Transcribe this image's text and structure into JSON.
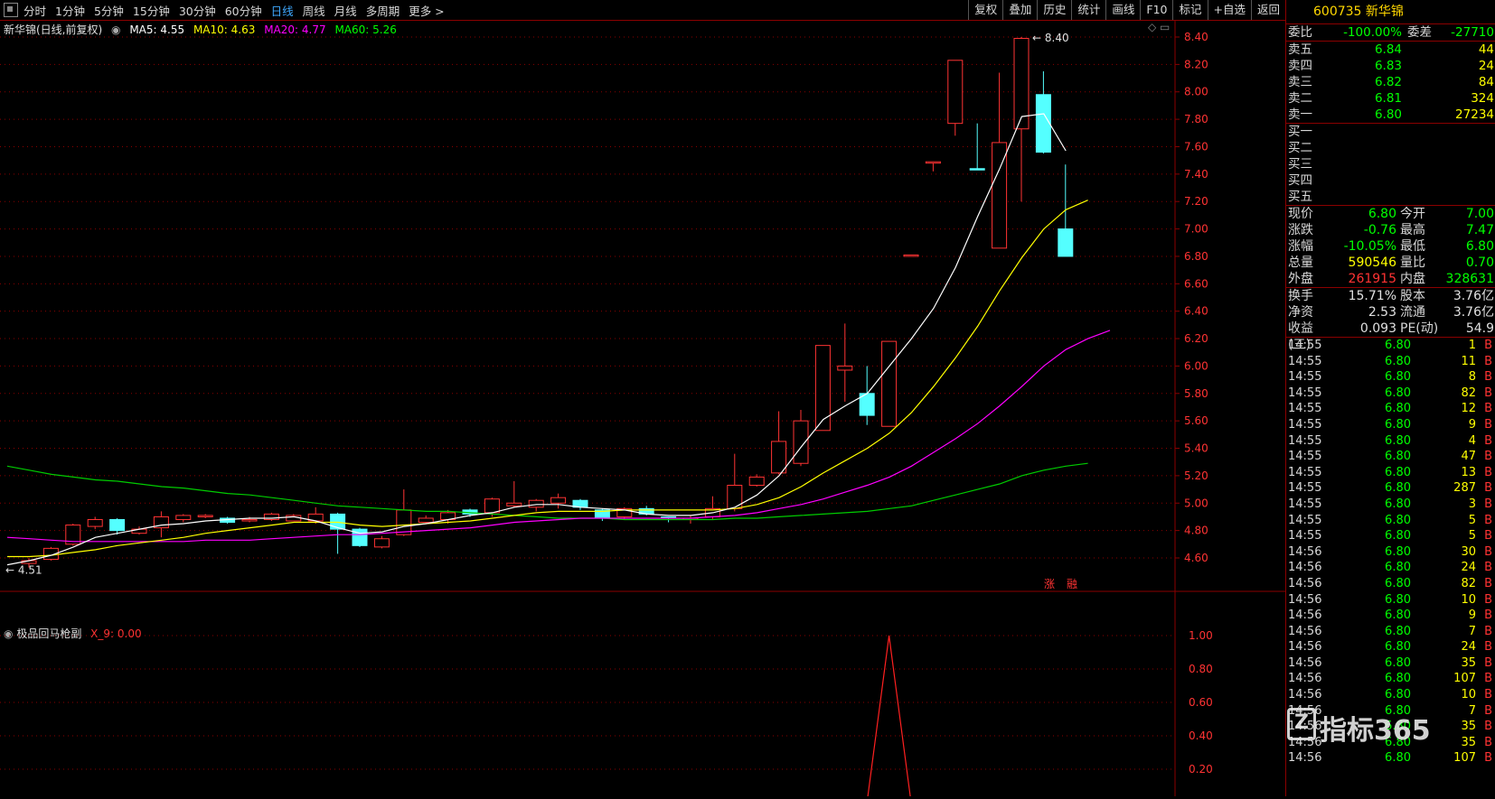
{
  "toolbar": {
    "periods": [
      "分时",
      "1分钟",
      "5分钟",
      "15分钟",
      "30分钟",
      "60分钟",
      "日线",
      "周线",
      "月线",
      "多周期",
      "更多 >"
    ],
    "active_period": "日线",
    "right_buttons": [
      "复权",
      "叠加",
      "历史",
      "统计",
      "画线",
      "F10",
      "标记",
      "+自选",
      "返回"
    ]
  },
  "legend": {
    "name": "新华锦(日线,前复权)",
    "ma5": "MA5: 4.55",
    "ma10": "MA10: 4.63",
    "ma20": "MA20: 4.77",
    "ma60": "MA60: 5.26"
  },
  "indicator_legend": {
    "name": "极品回马枪副",
    "x9": "X_9: 0.00"
  },
  "annotations": {
    "high_label": "8.40",
    "low_label": "4.51",
    "tag_zhang": "涨",
    "tag_shang": "融"
  },
  "colors": {
    "up": "#ff3333",
    "down": "#54ffff",
    "ma5": "#ffffff",
    "ma10": "#ffff00",
    "ma20": "#ff00ff",
    "ma60": "#00cc00",
    "grid": "#8b0000"
  },
  "chart_data": {
    "type": "candlestick",
    "price_axis": {
      "min": 4.4,
      "max": 8.5,
      "ticks": [
        "8.40",
        "8.20",
        "8.00",
        "7.80",
        "7.60",
        "7.40",
        "7.20",
        "7.00",
        "6.80",
        "6.60",
        "6.40",
        "6.20",
        "6.00",
        "5.80",
        "5.60",
        "5.40",
        "5.20",
        "5.00",
        "4.80",
        "4.60"
      ]
    },
    "candles": [
      {
        "o": 4.56,
        "c": 4.58,
        "h": 4.6,
        "l": 4.53
      },
      {
        "o": 4.59,
        "c": 4.67,
        "h": 4.68,
        "l": 4.58
      },
      {
        "o": 4.7,
        "c": 4.84,
        "h": 4.85,
        "l": 4.69
      },
      {
        "o": 4.83,
        "c": 4.88,
        "h": 4.9,
        "l": 4.81
      },
      {
        "o": 4.88,
        "c": 4.8,
        "h": 4.89,
        "l": 4.77
      },
      {
        "o": 4.78,
        "c": 4.81,
        "h": 4.83,
        "l": 4.77
      },
      {
        "o": 4.82,
        "c": 4.9,
        "h": 4.94,
        "l": 4.75
      },
      {
        "o": 4.88,
        "c": 4.91,
        "h": 4.92,
        "l": 4.86
      },
      {
        "o": 4.91,
        "c": 4.91,
        "h": 4.92,
        "l": 4.89
      },
      {
        "o": 4.89,
        "c": 4.86,
        "h": 4.9,
        "l": 4.85
      },
      {
        "o": 4.87,
        "c": 4.88,
        "h": 4.9,
        "l": 4.86
      },
      {
        "o": 4.88,
        "c": 4.92,
        "h": 4.93,
        "l": 4.87
      },
      {
        "o": 4.87,
        "c": 4.91,
        "h": 4.92,
        "l": 4.87
      },
      {
        "o": 4.87,
        "c": 4.92,
        "h": 4.97,
        "l": 4.85
      },
      {
        "o": 4.92,
        "c": 4.81,
        "h": 4.93,
        "l": 4.63
      },
      {
        "o": 4.81,
        "c": 4.69,
        "h": 4.82,
        "l": 4.68
      },
      {
        "o": 4.68,
        "c": 4.74,
        "h": 4.76,
        "l": 4.67
      },
      {
        "o": 4.77,
        "c": 4.95,
        "h": 5.1,
        "l": 4.76
      },
      {
        "o": 4.86,
        "c": 4.89,
        "h": 4.91,
        "l": 4.85
      },
      {
        "o": 4.88,
        "c": 4.93,
        "h": 4.95,
        "l": 4.85
      },
      {
        "o": 4.95,
        "c": 4.92,
        "h": 4.96,
        "l": 4.9
      },
      {
        "o": 4.93,
        "c": 5.03,
        "h": 5.04,
        "l": 4.9
      },
      {
        "o": 4.98,
        "c": 5.0,
        "h": 5.16,
        "l": 4.97
      },
      {
        "o": 4.97,
        "c": 5.02,
        "h": 5.03,
        "l": 4.94
      },
      {
        "o": 5.0,
        "c": 5.04,
        "h": 5.07,
        "l": 4.96
      },
      {
        "o": 5.02,
        "c": 4.97,
        "h": 5.03,
        "l": 4.95
      },
      {
        "o": 4.95,
        "c": 4.89,
        "h": 4.96,
        "l": 4.87
      },
      {
        "o": 4.9,
        "c": 4.96,
        "h": 4.97,
        "l": 4.88
      },
      {
        "o": 4.96,
        "c": 4.92,
        "h": 4.98,
        "l": 4.91
      },
      {
        "o": 4.9,
        "c": 4.89,
        "h": 4.9,
        "l": 4.86
      },
      {
        "o": 4.89,
        "c": 4.89,
        "h": 4.91,
        "l": 4.85
      },
      {
        "o": 4.9,
        "c": 4.96,
        "h": 5.05,
        "l": 4.88
      },
      {
        "o": 4.96,
        "c": 5.13,
        "h": 5.36,
        "l": 4.94
      },
      {
        "o": 5.13,
        "c": 5.19,
        "h": 5.21,
        "l": 5.12
      },
      {
        "o": 5.22,
        "c": 5.45,
        "h": 5.67,
        "l": 5.21
      },
      {
        "o": 5.29,
        "c": 5.6,
        "h": 5.68,
        "l": 5.27
      },
      {
        "o": 5.53,
        "c": 6.15,
        "h": 6.15,
        "l": 5.53
      },
      {
        "o": 5.97,
        "c": 6.0,
        "h": 6.31,
        "l": 5.74
      },
      {
        "o": 5.8,
        "c": 5.64,
        "h": 6.0,
        "l": 5.57
      },
      {
        "o": 5.56,
        "c": 6.18,
        "h": 6.18,
        "l": 5.56
      },
      {
        "o": 6.81,
        "c": 6.81,
        "h": 6.81,
        "l": 6.81
      },
      {
        "o": 7.49,
        "c": 7.49,
        "h": 7.49,
        "l": 7.42
      },
      {
        "o": 7.77,
        "c": 8.23,
        "h": 8.23,
        "l": 7.68
      },
      {
        "o": 7.44,
        "c": 7.43,
        "h": 7.77,
        "l": 7.43
      },
      {
        "o": 6.86,
        "c": 7.63,
        "h": 8.14,
        "l": 6.86
      },
      {
        "o": 7.73,
        "c": 8.39,
        "h": 8.4,
        "l": 7.2
      },
      {
        "o": 7.98,
        "c": 7.56,
        "h": 8.15,
        "l": 7.55
      },
      {
        "o": 7.0,
        "c": 6.8,
        "h": 7.47,
        "l": 6.8
      }
    ],
    "ma5": [
      4.55,
      4.58,
      4.62,
      4.68,
      4.75,
      4.78,
      4.81,
      4.84,
      4.85,
      4.87,
      4.88,
      4.89,
      4.89,
      4.9,
      4.87,
      4.82,
      4.78,
      4.79,
      4.83,
      4.85,
      4.88,
      4.91,
      4.93,
      4.97,
      4.99,
      4.99,
      4.97,
      4.96,
      4.95,
      4.92,
      4.91,
      4.91,
      4.93,
      4.97,
      5.06,
      5.2,
      5.41,
      5.61,
      5.71,
      5.8,
      6.0,
      6.2,
      6.42,
      6.72,
      7.09,
      7.44,
      7.82,
      7.84,
      7.57
    ],
    "ma10": [
      4.61,
      4.61,
      4.62,
      4.64,
      4.66,
      4.69,
      4.71,
      4.73,
      4.75,
      4.78,
      4.8,
      4.82,
      4.84,
      4.86,
      4.86,
      4.86,
      4.84,
      4.83,
      4.84,
      4.85,
      4.86,
      4.87,
      4.89,
      4.91,
      4.93,
      4.94,
      4.94,
      4.94,
      4.95,
      4.95,
      4.95,
      4.95,
      4.95,
      4.96,
      4.99,
      5.04,
      5.12,
      5.22,
      5.31,
      5.4,
      5.51,
      5.66,
      5.85,
      6.06,
      6.29,
      6.55,
      6.79,
      7.0,
      7.14,
      7.21
    ],
    "ma20": [
      4.75,
      4.74,
      4.73,
      4.72,
      4.72,
      4.72,
      4.72,
      4.72,
      4.72,
      4.73,
      4.73,
      4.73,
      4.74,
      4.75,
      4.76,
      4.77,
      4.77,
      4.78,
      4.79,
      4.8,
      4.81,
      4.82,
      4.84,
      4.86,
      4.87,
      4.88,
      4.89,
      4.89,
      4.89,
      4.89,
      4.89,
      4.89,
      4.9,
      4.91,
      4.93,
      4.96,
      4.99,
      5.03,
      5.08,
      5.13,
      5.19,
      5.27,
      5.37,
      5.47,
      5.58,
      5.71,
      5.85,
      6.0,
      6.12,
      6.2,
      6.26
    ],
    "ma60": [
      5.27,
      5.24,
      5.21,
      5.19,
      5.17,
      5.16,
      5.14,
      5.12,
      5.11,
      5.09,
      5.07,
      5.06,
      5.04,
      5.02,
      5.0,
      4.98,
      4.97,
      4.96,
      4.95,
      4.94,
      4.94,
      4.93,
      4.92,
      4.91,
      4.9,
      4.89,
      4.89,
      4.89,
      4.88,
      4.88,
      4.88,
      4.88,
      4.88,
      4.89,
      4.89,
      4.9,
      4.91,
      4.92,
      4.93,
      4.94,
      4.96,
      4.98,
      5.02,
      5.06,
      5.1,
      5.14,
      5.2,
      5.24,
      5.27,
      5.29
    ],
    "indicator": {
      "name": "极品回马枪副",
      "ticks": [
        "1.00",
        "0.80",
        "0.60",
        "0.40",
        "0.20"
      ],
      "min": 0.1,
      "max": 1.05,
      "values": [
        0,
        0,
        0,
        0,
        0,
        0,
        0,
        0,
        0,
        0,
        0,
        0,
        0,
        0,
        0,
        0,
        0,
        0,
        0,
        0,
        0,
        0,
        0,
        0,
        0,
        0,
        0,
        0,
        0,
        0,
        0,
        0,
        0,
        0,
        0,
        0,
        0,
        0,
        0,
        1,
        0,
        0,
        0,
        0,
        0,
        0,
        0,
        0,
        0
      ]
    }
  },
  "panel": {
    "code_name": "600735 新华锦",
    "weibi": {
      "label": "委比",
      "value": "-100.00%",
      "label2": "委差",
      "value2": "-27710"
    },
    "asks": [
      {
        "label": "卖五",
        "price": "6.84",
        "vol": "44"
      },
      {
        "label": "卖四",
        "price": "6.83",
        "vol": "24"
      },
      {
        "label": "卖三",
        "price": "6.82",
        "vol": "84"
      },
      {
        "label": "卖二",
        "price": "6.81",
        "vol": "324"
      },
      {
        "label": "卖一",
        "price": "6.80",
        "vol": "27234"
      }
    ],
    "bids": [
      {
        "label": "买一"
      },
      {
        "label": "买二"
      },
      {
        "label": "买三"
      },
      {
        "label": "买四"
      },
      {
        "label": "买五"
      }
    ],
    "quote": [
      {
        "l1": "现价",
        "v1": "6.80",
        "l2": "今开",
        "v2": "7.00",
        "c1": "green",
        "c2": "green"
      },
      {
        "l1": "涨跌",
        "v1": "-0.76",
        "l2": "最高",
        "v2": "7.47",
        "c1": "green",
        "c2": "green"
      },
      {
        "l1": "涨幅",
        "v1": "-10.05%",
        "l2": "最低",
        "v2": "6.80",
        "c1": "green",
        "c2": "green"
      },
      {
        "l1": "总量",
        "v1": "590546",
        "l2": "量比",
        "v2": "0.70",
        "c1": "yellow",
        "c2": "green"
      },
      {
        "l1": "外盘",
        "v1": "261915",
        "l2": "内盘",
        "v2": "328631",
        "c1": "red",
        "c2": "green"
      }
    ],
    "fund": [
      {
        "l1": "换手",
        "v1": "15.71%",
        "l2": "股本",
        "v2": "3.76亿"
      },
      {
        "l1": "净资",
        "v1": "2.53",
        "l2": "流通",
        "v2": "3.76亿"
      },
      {
        "l1": "收益(三)",
        "v1": "0.093",
        "l2": "PE(动)",
        "v2": "54.9"
      }
    ],
    "ticks": [
      {
        "t": "14:55",
        "p": "6.80",
        "v": "1",
        "s": "B"
      },
      {
        "t": "14:55",
        "p": "6.80",
        "v": "11",
        "s": "B"
      },
      {
        "t": "14:55",
        "p": "6.80",
        "v": "8",
        "s": "B"
      },
      {
        "t": "14:55",
        "p": "6.80",
        "v": "82",
        "s": "B"
      },
      {
        "t": "14:55",
        "p": "6.80",
        "v": "12",
        "s": "B"
      },
      {
        "t": "14:55",
        "p": "6.80",
        "v": "9",
        "s": "B"
      },
      {
        "t": "14:55",
        "p": "6.80",
        "v": "4",
        "s": "B"
      },
      {
        "t": "14:55",
        "p": "6.80",
        "v": "47",
        "s": "B"
      },
      {
        "t": "14:55",
        "p": "6.80",
        "v": "13",
        "s": "B"
      },
      {
        "t": "14:55",
        "p": "6.80",
        "v": "287",
        "s": "B"
      },
      {
        "t": "14:55",
        "p": "6.80",
        "v": "3",
        "s": "B"
      },
      {
        "t": "14:55",
        "p": "6.80",
        "v": "5",
        "s": "B"
      },
      {
        "t": "14:55",
        "p": "6.80",
        "v": "5",
        "s": "B"
      },
      {
        "t": "14:56",
        "p": "6.80",
        "v": "30",
        "s": "B"
      },
      {
        "t": "14:56",
        "p": "6.80",
        "v": "24",
        "s": "B"
      },
      {
        "t": "14:56",
        "p": "6.80",
        "v": "82",
        "s": "B"
      },
      {
        "t": "14:56",
        "p": "6.80",
        "v": "10",
        "s": "B"
      },
      {
        "t": "14:56",
        "p": "6.80",
        "v": "9",
        "s": "B"
      },
      {
        "t": "14:56",
        "p": "6.80",
        "v": "7",
        "s": "B"
      },
      {
        "t": "14:56",
        "p": "6.80",
        "v": "24",
        "s": "B"
      },
      {
        "t": "14:56",
        "p": "6.80",
        "v": "35",
        "s": "B"
      },
      {
        "t": "14:56",
        "p": "6.80",
        "v": "107",
        "s": "B"
      },
      {
        "t": "14:56",
        "p": "6.80",
        "v": "10",
        "s": "B"
      },
      {
        "t": "14:56",
        "p": "6.80",
        "v": "7",
        "s": "B"
      },
      {
        "t": "14:56",
        "p": "6.80",
        "v": "35",
        "s": "B"
      },
      {
        "t": "14:56",
        "p": "6.80",
        "v": "35",
        "s": "B"
      },
      {
        "t": "14:56",
        "p": "6.80",
        "v": "107",
        "s": "B"
      }
    ]
  },
  "watermark": {
    "logo": "Z",
    "text": "指标365"
  }
}
